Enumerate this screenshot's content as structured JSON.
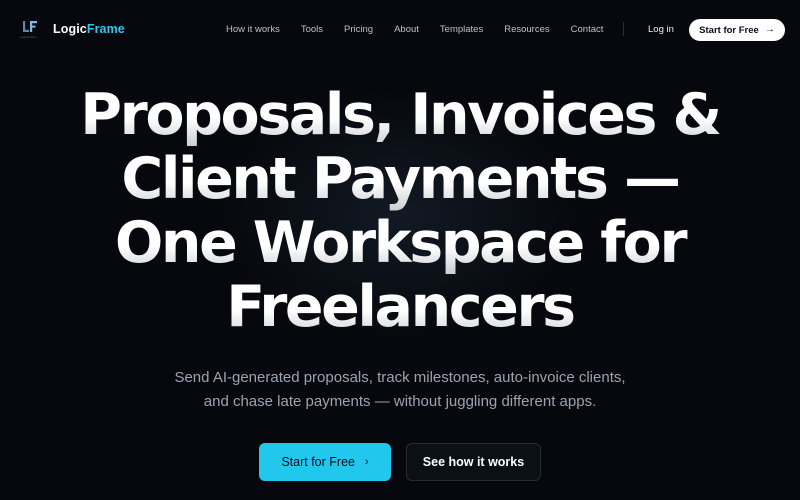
{
  "nav": {
    "brand": {
      "part1": "Logic",
      "part2": "Frame",
      "tagline": "LogicFrame",
      "accent": "#2cc8f0"
    },
    "links": [
      "How it works",
      "Tools",
      "Pricing",
      "About",
      "Templates",
      "Resources",
      "Contact"
    ],
    "login": "Log in",
    "cta": {
      "label": "Start for Free",
      "icon": "arrow-right-icon",
      "glyph": "→"
    }
  },
  "hero": {
    "title_lines": [
      "Proposals, Invoices &",
      "Client Payments —",
      "One Workspace for",
      "Freelancers"
    ],
    "subtitle_lines": [
      "Send AI-generated proposals, track milestones, auto-invoice clients,",
      "and chase late payments — without juggling different apps."
    ],
    "primary_cta": {
      "label": "Start for Free",
      "icon": "chevron-right-icon",
      "glyph": "›",
      "color": "#22c7ee"
    },
    "secondary_cta": {
      "label": "See how it works"
    }
  },
  "colors": {
    "background": "#06080d",
    "text_muted": "#9aa3b2",
    "nav_text": "#b9c0cc"
  }
}
